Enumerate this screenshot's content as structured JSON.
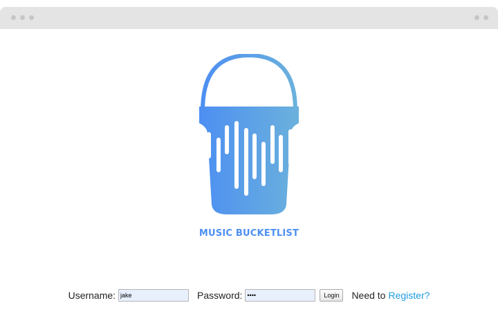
{
  "window": {
    "controls_left": [
      "dot",
      "dot",
      "dot"
    ],
    "controls_right": [
      "dot",
      "dot"
    ]
  },
  "logo": {
    "icon": "music-bucket-logo",
    "brand_name": "MUSIC BUCKETLIST",
    "gradient_start": "#4d8ff2",
    "gradient_end": "#6bb1dc"
  },
  "login_form": {
    "username_label": "Username:",
    "username_value": "jake",
    "password_label": "Password:",
    "password_value": "••••",
    "login_button": "Login",
    "register_prompt": "Need to",
    "register_link": "Register?",
    "link_color": "#1e9be0"
  }
}
